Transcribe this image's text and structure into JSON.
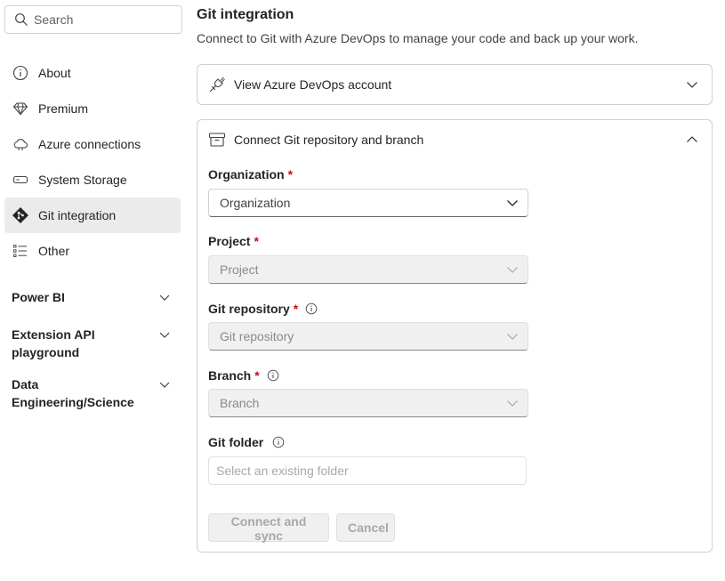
{
  "search": {
    "placeholder": "Search"
  },
  "sidebar": {
    "items": [
      {
        "label": "About",
        "icon": "info-icon",
        "active": false
      },
      {
        "label": "Premium",
        "icon": "diamond-icon",
        "active": false
      },
      {
        "label": "Azure connections",
        "icon": "cloud-icon",
        "active": false
      },
      {
        "label": "System Storage",
        "icon": "storage-icon",
        "active": false
      },
      {
        "label": "Git integration",
        "icon": "git-icon",
        "active": true
      },
      {
        "label": "Other",
        "icon": "list-icon",
        "active": false
      }
    ],
    "groups": [
      {
        "label": "Power BI"
      },
      {
        "label": "Extension API playground"
      },
      {
        "label": "Data Engineering/Science"
      }
    ]
  },
  "main": {
    "title": "Git integration",
    "subtitle": "Connect to Git with Azure DevOps to manage your code and back up your work.",
    "account_section": {
      "label": "View Azure DevOps account",
      "expanded": false
    },
    "repo_section": {
      "label": "Connect Git repository and branch",
      "expanded": true,
      "required_mark": "*",
      "organization": {
        "label": "Organization",
        "value": "Organization"
      },
      "project": {
        "label": "Project",
        "value": "Project"
      },
      "repository": {
        "label": "Git repository",
        "value": "Git repository"
      },
      "branch": {
        "label": "Branch",
        "value": "Branch"
      },
      "folder": {
        "label": "Git folder",
        "placeholder": "Select an existing folder"
      },
      "connect_button": "Connect and sync",
      "cancel_button": "Cancel"
    }
  },
  "colors": {
    "required": "#c50f1f",
    "active_bg": "#ebebeb",
    "disabled_bg": "#f0f0f0"
  }
}
